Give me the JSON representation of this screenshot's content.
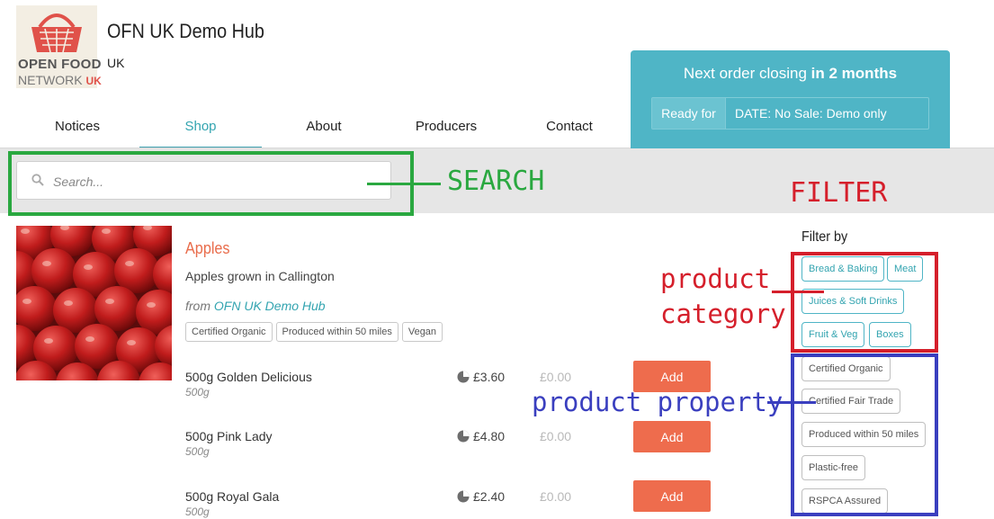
{
  "header": {
    "logo": {
      "line1": "OPEN FOOD",
      "line2": "NETWORK",
      "line2_suffix": "UK"
    },
    "hub_name": "OFN UK Demo Hub",
    "hub_country": "UK"
  },
  "tabs": [
    {
      "label": "Notices",
      "active": false
    },
    {
      "label": "Shop",
      "active": true
    },
    {
      "label": "About",
      "active": false
    },
    {
      "label": "Producers",
      "active": false
    },
    {
      "label": "Contact",
      "active": false
    }
  ],
  "order": {
    "title_prefix": "Next order closing",
    "title_emphasis": "in 2 months",
    "ready_label": "Ready for",
    "ready_value": "DATE: No Sale: Demo only"
  },
  "search": {
    "placeholder": "Search..."
  },
  "product": {
    "name": "Apples",
    "description": "Apples grown in Callington",
    "from_prefix": "from",
    "from_hub": "OFN UK Demo Hub",
    "tags": [
      "Certified Organic",
      "Produced within 50 miles",
      "Vegan"
    ],
    "variants": [
      {
        "name": "500g Golden Delicious",
        "unit": "500g",
        "price": "£3.60",
        "total": "£0.00",
        "button": "Add"
      },
      {
        "name": "500g Pink Lady",
        "unit": "500g",
        "price": "£4.80",
        "total": "£0.00",
        "button": "Add"
      },
      {
        "name": "500g Royal Gala",
        "unit": "500g",
        "price": "£2.40",
        "total": "£0.00",
        "button": "Add"
      }
    ]
  },
  "filter": {
    "title": "Filter by",
    "categories": [
      "Bread & Baking",
      "Meat",
      "Juices & Soft Drinks",
      "Fruit & Veg",
      "Boxes"
    ],
    "properties": [
      "Certified Organic",
      "Certified Fair Trade",
      "Produced within 50 miles",
      "Plastic-free",
      "RSPCA Assured"
    ]
  },
  "annotations": {
    "search": "SEARCH",
    "filter": "FILTER",
    "category_line1": "product",
    "category_line2": "category",
    "property": "product property"
  },
  "colors": {
    "accent_teal": "#4fb5c6",
    "add_button": "#ee6c4d",
    "product_name": "#e96d4c",
    "annotation_green": "#2aa840",
    "annotation_red": "#d51f2b",
    "annotation_blue": "#3a3fbf"
  }
}
